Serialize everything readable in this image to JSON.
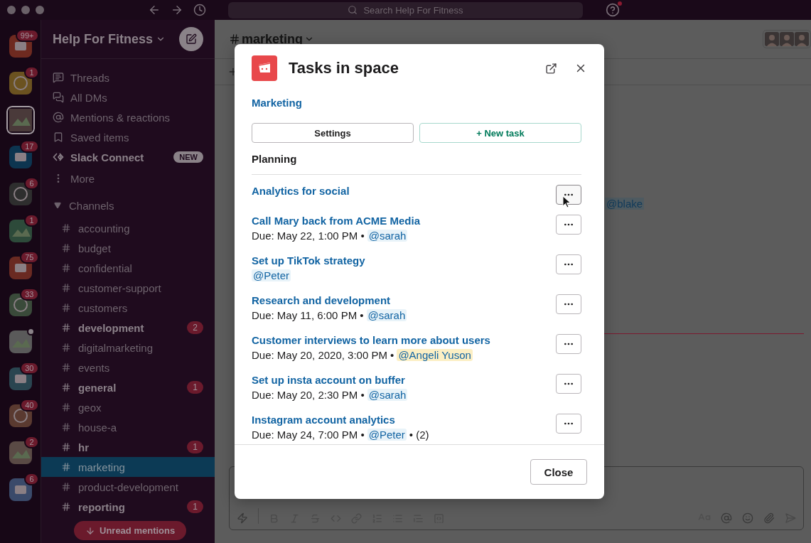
{
  "top_bar": {
    "search_placeholder": "Search Help For Fitness"
  },
  "workspaces": [
    {
      "color": "#6e2a20",
      "badge": "99+",
      "selected": false,
      "status_dot": false
    },
    {
      "color": "#6b5220",
      "badge": "1",
      "selected": false,
      "status_dot": false
    },
    {
      "color": "#4a3a3a",
      "selected": true,
      "status_dot": false
    },
    {
      "color": "#0d3550",
      "badge": "17",
      "selected": false,
      "status_dot": false
    },
    {
      "color": "#2e2e2e",
      "badge": "6",
      "selected": false,
      "status_dot": false
    },
    {
      "color": "#2d4a3a",
      "badge": "1",
      "selected": false,
      "status_dot": false
    },
    {
      "color": "#6a2a22",
      "badge": "75",
      "selected": false,
      "status_dot": false
    },
    {
      "color": "#3a4a3a",
      "badge": "33",
      "selected": false,
      "status_dot": false
    },
    {
      "color": "#5a5a5a",
      "selected": false,
      "status_dot": true
    },
    {
      "color": "#2a4550",
      "badge": "30",
      "selected": false,
      "status_dot": false
    },
    {
      "color": "#5a3a30",
      "badge": "40",
      "selected": false,
      "status_dot": false
    },
    {
      "color": "#5a4a45",
      "badge": "2",
      "selected": false,
      "status_dot": false
    },
    {
      "color": "#3a4a6a",
      "badge": "6",
      "selected": false,
      "status_dot": false
    }
  ],
  "sidebar": {
    "workspace_name": "Help For Fitness",
    "nav": [
      {
        "kind": "threads",
        "label": "Threads"
      },
      {
        "kind": "dms",
        "label": "All DMs"
      },
      {
        "kind": "mentions",
        "label": "Mentions & reactions"
      },
      {
        "kind": "saved",
        "label": "Saved items"
      },
      {
        "kind": "connect",
        "label": "Slack Connect",
        "badge": "NEW"
      },
      {
        "kind": "more",
        "label": "More"
      }
    ],
    "section": {
      "label": "Channels",
      "expanded": true
    },
    "channels": [
      {
        "name": "accounting",
        "unread": false,
        "selected": false
      },
      {
        "name": "budget",
        "unread": false,
        "selected": false
      },
      {
        "name": "confidential",
        "unread": false,
        "selected": false
      },
      {
        "name": "customer-support",
        "unread": false,
        "selected": false
      },
      {
        "name": "customers",
        "unread": false,
        "selected": false
      },
      {
        "name": "development",
        "unread": true,
        "count": "2",
        "selected": false
      },
      {
        "name": "digitalmarketing",
        "unread": false,
        "selected": false
      },
      {
        "name": "events",
        "unread": false,
        "selected": false
      },
      {
        "name": "general",
        "unread": true,
        "count": "1",
        "selected": false
      },
      {
        "name": "geox",
        "unread": false,
        "selected": false
      },
      {
        "name": "house-a",
        "unread": false,
        "selected": false
      },
      {
        "name": "hr",
        "unread": true,
        "count": "1",
        "selected": false
      },
      {
        "name": "marketing",
        "unread": false,
        "selected": true
      },
      {
        "name": "product-development",
        "unread": false,
        "selected": false
      },
      {
        "name": "reporting",
        "unread": true,
        "count": "1",
        "selected": false
      }
    ],
    "unread_button": "Unread mentions"
  },
  "channel": {
    "name": "marketing",
    "mention": "@blake"
  },
  "modal": {
    "title": "Tasks in space",
    "space_link": "Marketing",
    "buttons": [
      "Settings",
      "+ New task"
    ],
    "section": "Planning",
    "tasks": [
      {
        "title": "Analytics for social",
        "hovered": true
      },
      {
        "title": "Call Mary back from ACME Media",
        "hovered": false,
        "meta": [
          {
            "kind": "text",
            "text": "Due: May 22, 1:00 PM •"
          },
          {
            "kind": "mention",
            "text": "@sarah",
            "highlighted": false
          }
        ]
      },
      {
        "title": "Set up TikTok strategy",
        "hovered": false,
        "meta": [
          {
            "kind": "mention",
            "text": "@Peter",
            "highlighted": false
          }
        ]
      },
      {
        "title": "Research and development",
        "hovered": false,
        "meta": [
          {
            "kind": "text",
            "text": "Due: May 11, 6:00 PM •"
          },
          {
            "kind": "mention",
            "text": "@sarah",
            "highlighted": false
          }
        ]
      },
      {
        "title": "Customer interviews to learn more about users",
        "hovered": false,
        "meta": [
          {
            "kind": "text",
            "text": "Due: May 20, 2020, 3:00 PM •"
          },
          {
            "kind": "mention",
            "text": "@Angeli Yuson",
            "highlighted": true
          }
        ]
      },
      {
        "title": "Set up insta account on buffer",
        "hovered": false,
        "meta": [
          {
            "kind": "text",
            "text": "Due: May 20, 2:30 PM •"
          },
          {
            "kind": "mention",
            "text": "@sarah",
            "highlighted": false
          }
        ]
      },
      {
        "title": "Instagram account analytics",
        "hovered": false,
        "meta": [
          {
            "kind": "text",
            "text": "Due: May 24, 7:00 PM •"
          },
          {
            "kind": "mention",
            "text": "@Peter",
            "highlighted": false
          },
          {
            "kind": "text",
            "text": "• (2)"
          }
        ]
      }
    ],
    "close": "Close"
  }
}
